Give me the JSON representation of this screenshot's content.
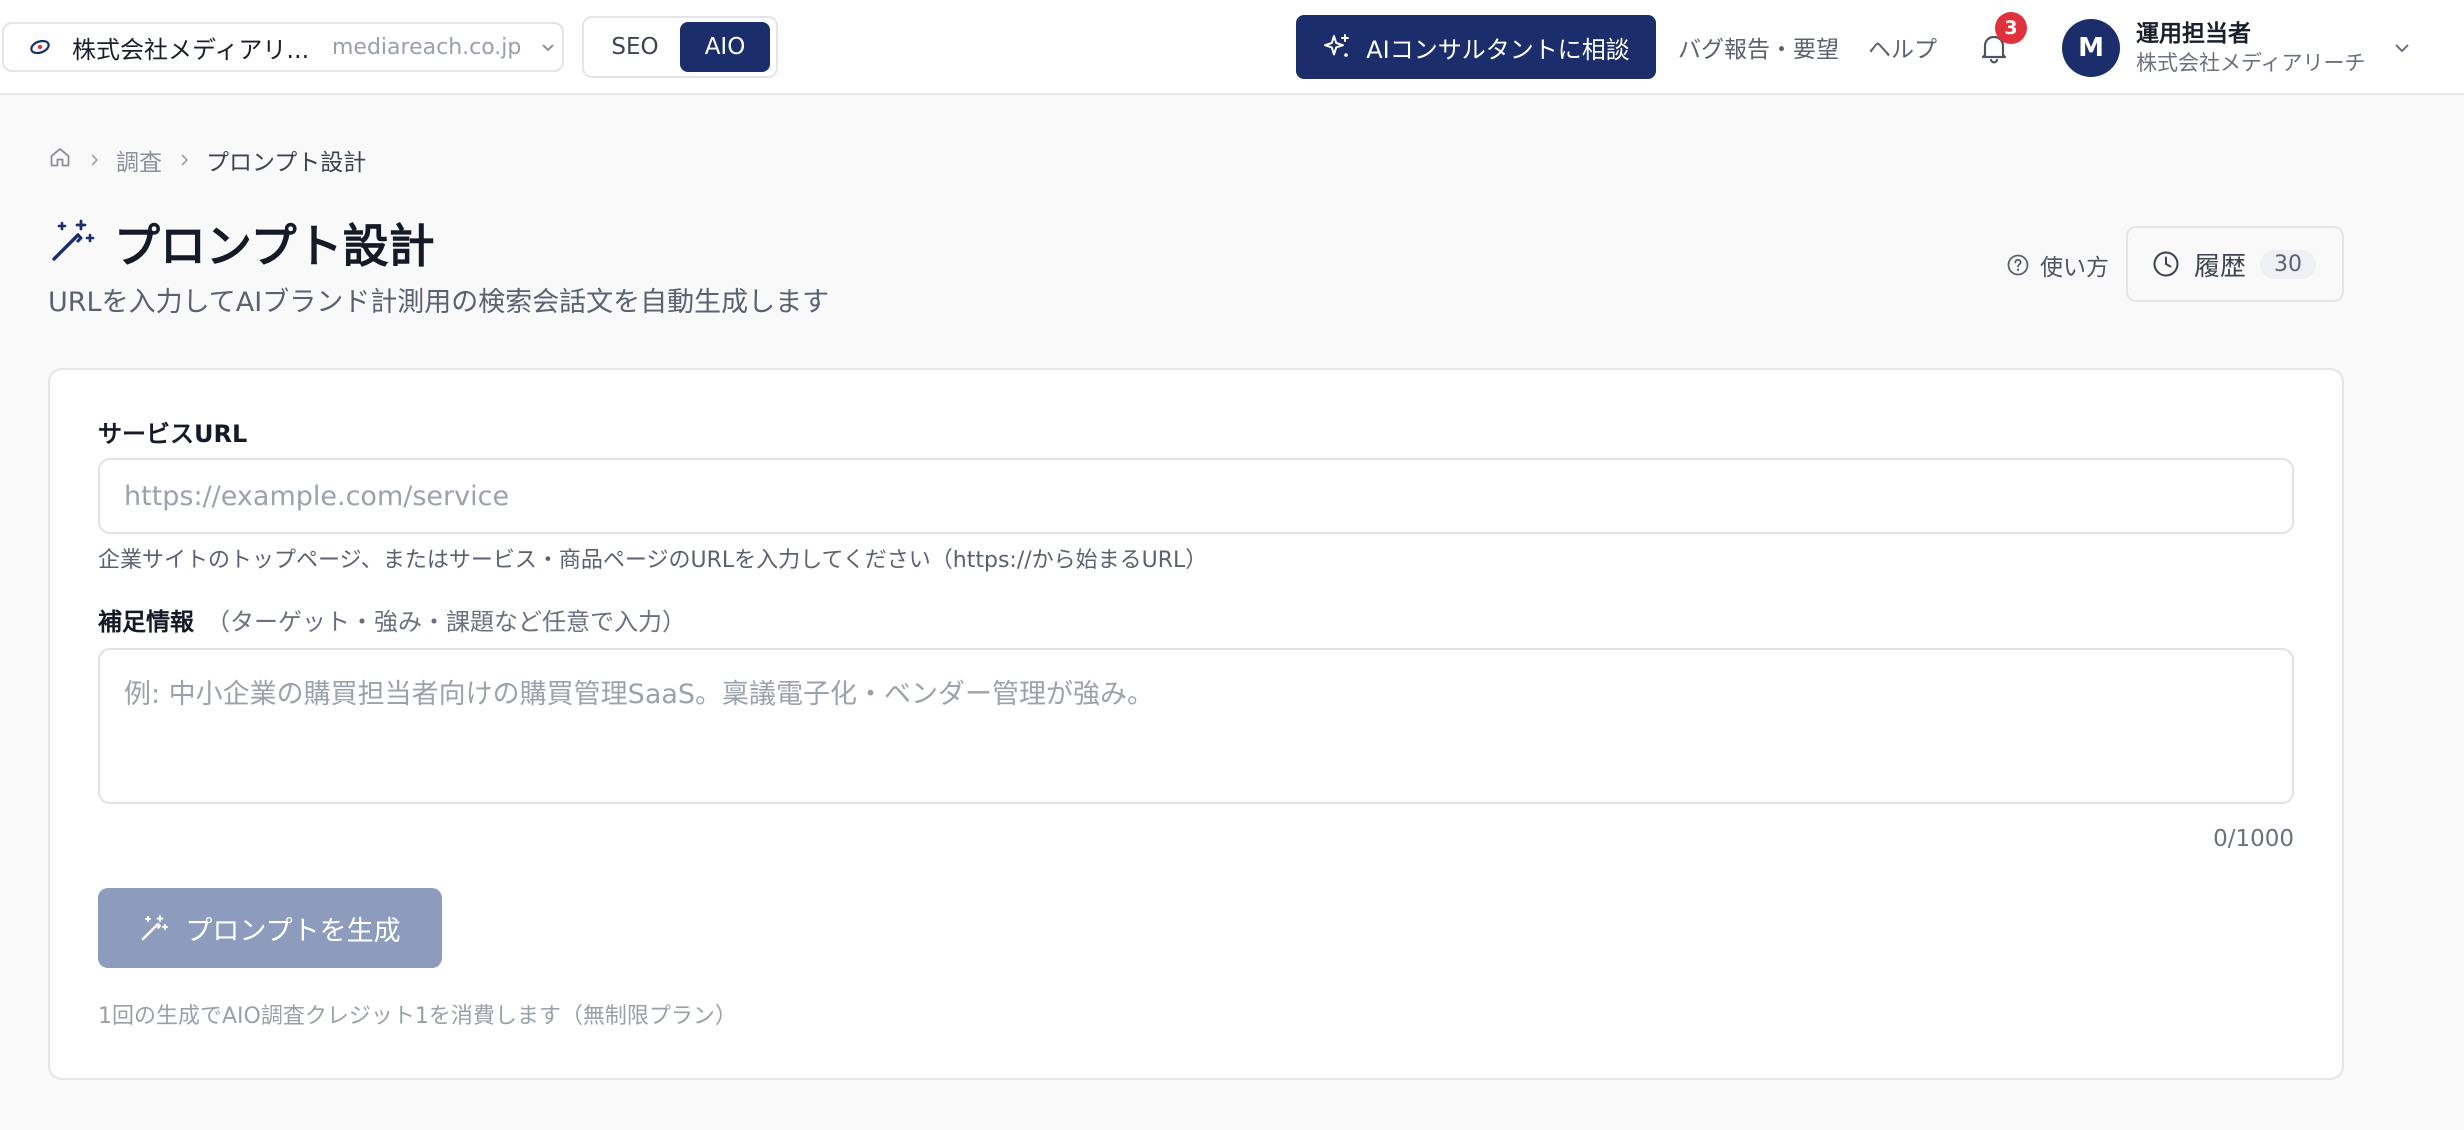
{
  "header": {
    "company": {
      "name": "株式会社メディアリ...",
      "domain": "mediareach.co.jp"
    },
    "modes": [
      {
        "label": "SEO",
        "active": false
      },
      {
        "label": "AIO",
        "active": true
      }
    ],
    "consult_label": "AIコンサルタントに相談",
    "links": {
      "feedback": "バグ報告・要望",
      "help": "ヘルプ"
    },
    "notifications_count": "3",
    "user": {
      "initial": "M",
      "name": "運用担当者",
      "org": "株式会社メディアリーチ"
    }
  },
  "breadcrumb": {
    "items": [
      "調査",
      "プロンプト設計"
    ]
  },
  "page": {
    "title": "プロンプト設計",
    "subtitle": "URLを入力してAIブランド計測用の検索会話文を自動生成します",
    "howto_label": "使い方",
    "history_label": "履歴",
    "history_count": "30"
  },
  "form": {
    "url_label": "サービスURL",
    "url_value": "",
    "url_placeholder": "https://example.com/service",
    "url_help": "企業サイトのトップページ、またはサービス・商品ページのURLを入力してください（https://から始まるURL）",
    "note_label": "補足情報",
    "note_hint": "（ターゲット・強み・課題など任意で入力）",
    "note_value": "",
    "note_placeholder": "例: 中小企業の購買担当者向けの購買管理SaaS。稟議電子化・ベンダー管理が強み。",
    "char_count": "0/1000",
    "generate_label": "プロンプトを生成",
    "credit_note": "1回の生成でAIO調査クレジット1を消費します（無制限プラン）"
  },
  "colors": {
    "brand_navy": "#1b2d6b",
    "disabled_button": "#8d9cbc",
    "badge_red": "#e0323c"
  }
}
